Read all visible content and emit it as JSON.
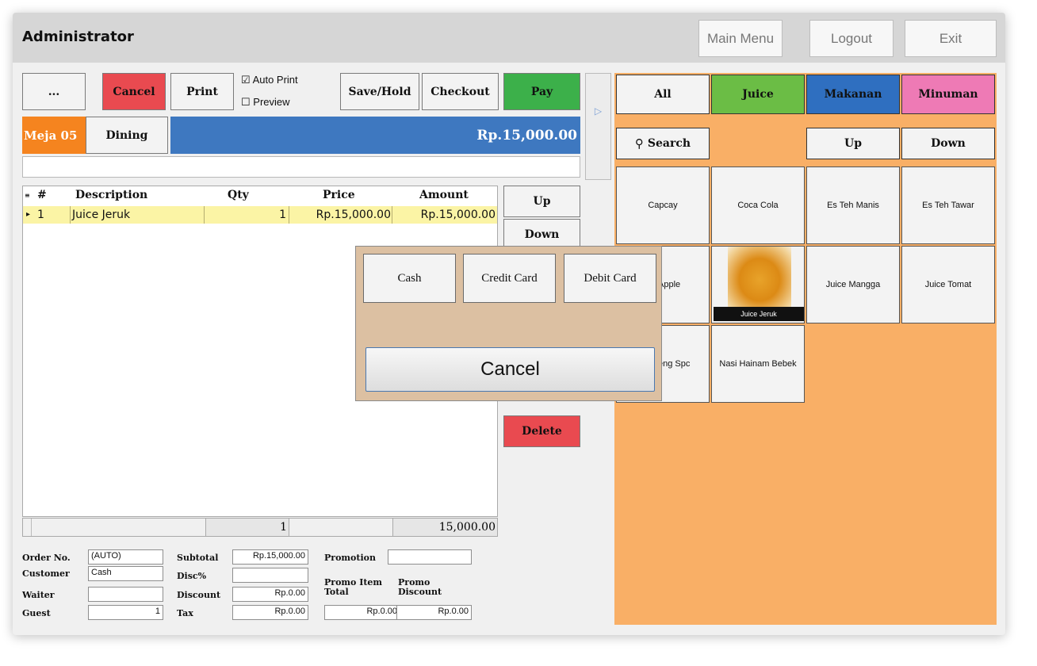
{
  "header": {
    "title": "Administrator",
    "main_menu": "Main Menu",
    "logout": "Logout",
    "exit": "Exit"
  },
  "toolbar": {
    "more": "...",
    "cancel": "Cancel",
    "print": "Print",
    "auto_print": "Auto Print",
    "preview": "Preview",
    "save_hold": "Save/Hold",
    "checkout": "Checkout",
    "pay": "Pay"
  },
  "order": {
    "table": "Meja 05",
    "mode": "Dining",
    "total": "Rp.15,000.00"
  },
  "grid": {
    "columns": [
      "#",
      "Description",
      "Qty",
      "Price",
      "Amount"
    ],
    "rows": [
      {
        "no": "1",
        "description": "Juice Jeruk",
        "qty": "1",
        "price": "Rp.15,000.00",
        "amount": "Rp.15,000.00"
      }
    ],
    "footer_qty": "1",
    "footer_amount": "15,000.00"
  },
  "side_buttons": {
    "up": "Up",
    "down": "Down",
    "delete": "Delete"
  },
  "summary": {
    "order_no_label": "Order No.",
    "order_no": "(AUTO)",
    "customer_label": "Customer",
    "customer": "Cash",
    "waiter_label": "Waiter",
    "waiter": "",
    "guest_label": "Guest",
    "guest": "1",
    "subtotal_label": "Subtotal",
    "subtotal": "Rp.15,000.00",
    "disc_pct_label": "Disc%",
    "disc_pct": "",
    "discount_label": "Discount",
    "discount": "Rp.0.00",
    "tax_label": "Tax",
    "tax": "Rp.0.00",
    "promotion_label": "Promotion",
    "promotion": "",
    "promo_item_total_label_1": "Promo Item",
    "promo_item_total_label_2": "Total",
    "promo_item_total": "Rp.0.00",
    "promo_discount_label_1": "Promo",
    "promo_discount_label_2": "Discount",
    "promo_discount": "Rp.0.00"
  },
  "categories": [
    {
      "label": "All",
      "color": "#f3f3f3"
    },
    {
      "label": "Juice",
      "color": "#6bbd45"
    },
    {
      "label": "Makanan",
      "color": "#2f6fc0"
    },
    {
      "label": "Minuman",
      "color": "#ee7ab5"
    }
  ],
  "menu_nav": {
    "search": "Search",
    "up": "Up",
    "down": "Down"
  },
  "items": [
    "Capcay",
    "Coca Cola",
    "Es Teh Manis",
    "Es Teh Tawar",
    "Juice Apple",
    "Juice Jeruk",
    "Juice Mangga",
    "Juice Tomat",
    "Kwetiaw Goreng Spc",
    "Nasi Hainam Bebek"
  ],
  "visible_items": {
    "item_4": "Apple",
    "item_8": "eng Spc"
  },
  "payment_popup": {
    "cash": "Cash",
    "credit_card": "Credit Card",
    "debit_card": "Debit Card",
    "cancel": "Cancel"
  },
  "colors": {
    "accent_orange": "#f5841f",
    "total_blue": "#3e78c0",
    "panel_orange": "#f9af66",
    "cancel_red": "#e94a50",
    "pay_green": "#3cb04a"
  }
}
